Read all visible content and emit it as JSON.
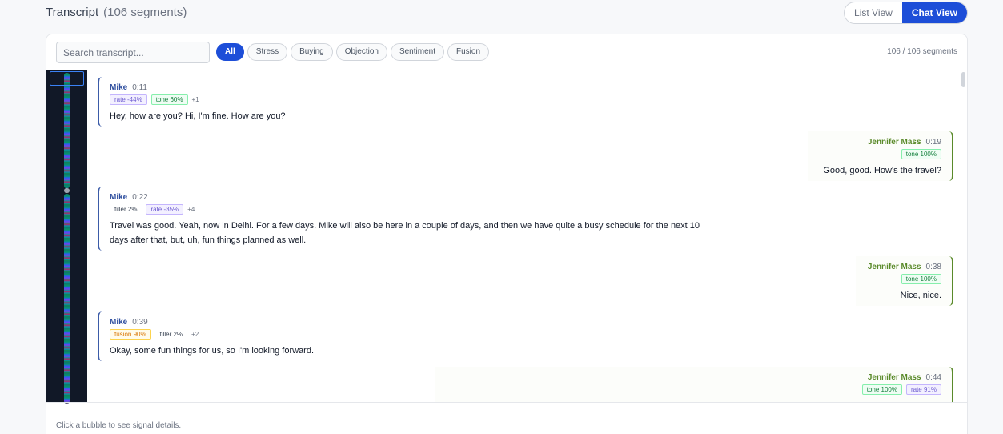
{
  "header": {
    "title": "Transcript",
    "count": "(106 segments)"
  },
  "view_toggle": {
    "list_label": "List View",
    "chat_label": "Chat View"
  },
  "toolbar": {
    "search_placeholder": "Search transcript...",
    "filters": [
      "All",
      "Stress",
      "Buying",
      "Objection",
      "Sentiment",
      "Fusion"
    ],
    "active_filter": "All",
    "segment_count": "106 / 106 segments"
  },
  "messages": [
    {
      "speaker": "Mike",
      "time": "0:11",
      "tags": [
        "rate -44%",
        "tone 60%"
      ],
      "more": "+1",
      "text": "Hey, how are you? Hi, I'm fine. How are you?"
    },
    {
      "speaker": "Jennifer Mass",
      "time": "0:19",
      "tags": [
        "tone 100%"
      ],
      "more": "",
      "text": "Good, good. How's the travel?"
    },
    {
      "speaker": "Mike",
      "time": "0:22",
      "tags": [
        "filler 2%",
        "rate -35%"
      ],
      "more": "+4",
      "text": "Travel was good. Yeah, now in Delhi. For a few days. Mike will also be here in a couple of days, and then we have quite a busy schedule for the next 10 days after that, but, uh, fun things planned as well."
    },
    {
      "speaker": "Jennifer Mass",
      "time": "0:38",
      "tags": [
        "tone 100%"
      ],
      "more": "",
      "text": "Nice, nice."
    },
    {
      "speaker": "Mike",
      "time": "0:39",
      "tags": [
        "fusion 90%",
        "filler 2%"
      ],
      "more": "+2",
      "text": "Okay, some fun things for us, so I'm looking forward."
    },
    {
      "speaker": "Jennifer Mass",
      "time": "0:44",
      "tags": [
        "tone 100%",
        "rate 91%"
      ],
      "more": "",
      "text": ""
    }
  ],
  "footer": {
    "hint": "Click a bubble to see signal details."
  }
}
